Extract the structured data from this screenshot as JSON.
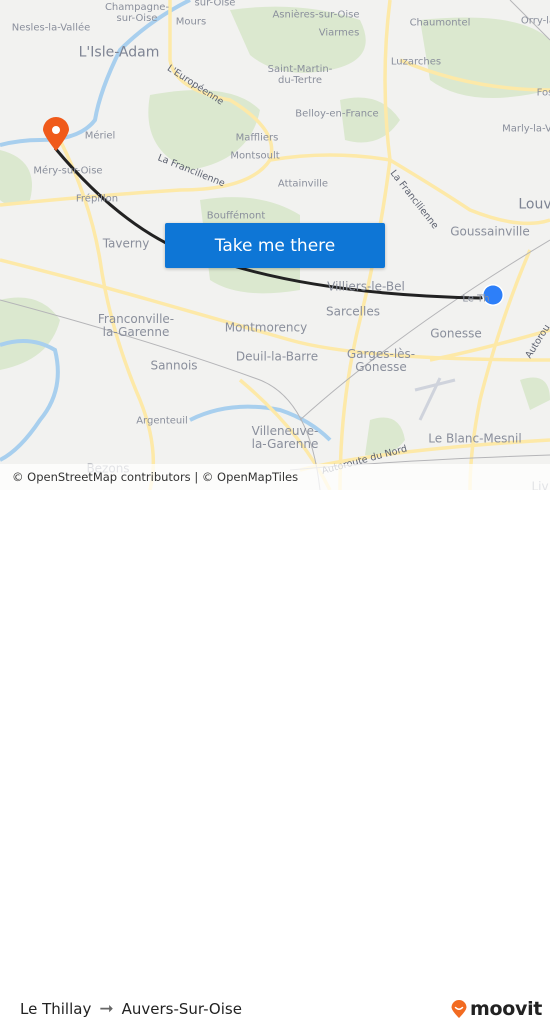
{
  "map": {
    "places": [
      {
        "name": "Champagne-sur-Oise",
        "lines": [
          "Champagne-",
          "sur-Oise"
        ]
      },
      {
        "name": "sur-Oise",
        "lines": [
          "sur-Oise"
        ]
      },
      {
        "name": "Mours",
        "lines": [
          "Mours"
        ]
      },
      {
        "name": "Nesles-la-Vallée",
        "lines": [
          "Nesles-la-Vallée"
        ]
      },
      {
        "name": "L'Isle-Adam",
        "lines": [
          "L'Isle-Adam"
        ]
      },
      {
        "name": "Asnières-sur-Oise",
        "lines": [
          "Asnières-sur-Oise"
        ]
      },
      {
        "name": "Viarmes",
        "lines": [
          "Viarmes"
        ]
      },
      {
        "name": "Chaumontel",
        "lines": [
          "Chaumontel"
        ]
      },
      {
        "name": "Orry-la",
        "lines": [
          "Orry-la"
        ]
      },
      {
        "name": "Luzarches",
        "lines": [
          "Luzarches"
        ]
      },
      {
        "name": "Saint-Martin-du-Tertre",
        "lines": [
          "Saint-Martin-",
          "du-Tertre"
        ]
      },
      {
        "name": "Belloy-en-France",
        "lines": [
          "Belloy-en-France"
        ]
      },
      {
        "name": "Fos",
        "lines": [
          "Fos"
        ]
      },
      {
        "name": "Marly-la-V",
        "lines": [
          "Marly-la-V"
        ]
      },
      {
        "name": "Mériel",
        "lines": [
          "Mériel"
        ]
      },
      {
        "name": "Maffliers",
        "lines": [
          "Maffliers"
        ]
      },
      {
        "name": "Montsoult",
        "lines": [
          "Montsoult"
        ]
      },
      {
        "name": "Méry-sur-Oise",
        "lines": [
          "Méry-sur-Oise"
        ]
      },
      {
        "name": "Attainville",
        "lines": [
          "Attainville"
        ]
      },
      {
        "name": "Frépillon",
        "lines": [
          "Frépillon"
        ]
      },
      {
        "name": "Bouffémont",
        "lines": [
          "Bouffémont"
        ]
      },
      {
        "name": "Louv",
        "lines": [
          "Louv"
        ]
      },
      {
        "name": "Taverny",
        "lines": [
          "Taverny"
        ]
      },
      {
        "name": "Goussainville",
        "lines": [
          "Goussainville"
        ]
      },
      {
        "name": "Villiers-le-Bel",
        "lines": [
          "Villiers-le-Bel"
        ]
      },
      {
        "name": "Le Thillay",
        "lines": [
          "Le Th"
        ]
      },
      {
        "name": "Franconville-la-Garenne",
        "lines": [
          "Franconville-",
          "la-Garenne"
        ]
      },
      {
        "name": "Sarcelles",
        "lines": [
          "Sarcelles"
        ]
      },
      {
        "name": "Montmorency",
        "lines": [
          "Montmorency"
        ]
      },
      {
        "name": "Gonesse",
        "lines": [
          "Gonesse"
        ]
      },
      {
        "name": "Deuil-la-Barre",
        "lines": [
          "Deuil-la-Barre"
        ]
      },
      {
        "name": "Garges-lès-Gonesse",
        "lines": [
          "Garges-lès-",
          "Gonesse"
        ]
      },
      {
        "name": "Sannois",
        "lines": [
          "Sannois"
        ]
      },
      {
        "name": "Argenteuil",
        "lines": [
          "Argenteuil"
        ]
      },
      {
        "name": "Villeneuve-la-Garenne",
        "lines": [
          "Villeneuve-",
          "la-Garenne"
        ]
      },
      {
        "name": "Le Blanc-Mesnil",
        "lines": [
          "Le Blanc-Mesnil"
        ]
      },
      {
        "name": "Bezons",
        "lines": [
          "Bezons"
        ]
      },
      {
        "name": "Liv",
        "lines": [
          "Liv"
        ]
      }
    ],
    "roads": [
      {
        "name": "L'Européenne"
      },
      {
        "name": "La Francilienne"
      },
      {
        "name": "La Francilienne"
      },
      {
        "name": "Autoroute du Nord"
      },
      {
        "name": "Autorou"
      }
    ],
    "origin_marker": {
      "label": "Le Thillay",
      "color": "#2d7ff9"
    },
    "destination_marker": {
      "label": "Auvers-Sur-Oise",
      "color": "#f05a1a"
    },
    "route_color": "#222222"
  },
  "cta": {
    "label": "Take me there"
  },
  "attribution": "© OpenStreetMap contributors | © OpenMapTiles",
  "footer": {
    "origin": "Le Thillay",
    "destination": "Auvers-Sur-Oise",
    "brand": "moovit",
    "brand_color": "#f26b21"
  }
}
